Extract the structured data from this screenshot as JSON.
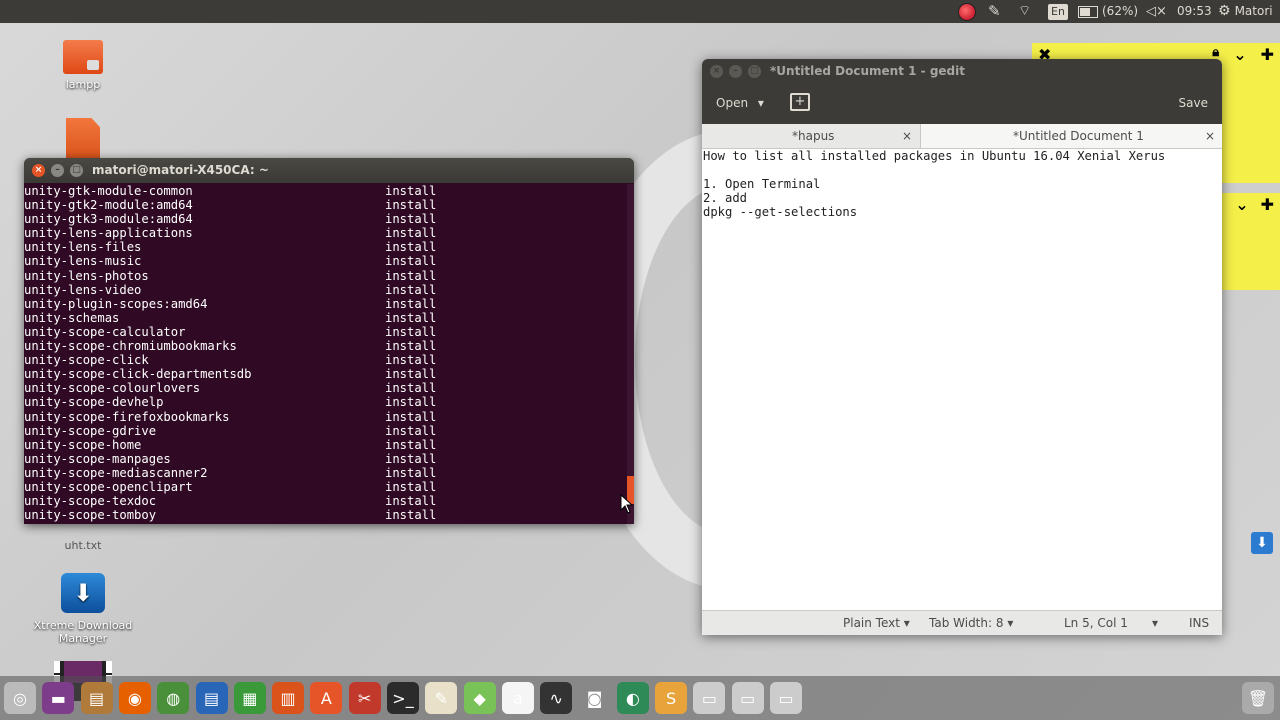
{
  "top_panel": {
    "keyboard": "En",
    "battery": "(62%)",
    "time": "09:53",
    "user": "Matori"
  },
  "desktop_icons": [
    {
      "label": "lampp"
    },
    {
      "label": "uht.txt"
    },
    {
      "label": "Xtreme Download Manager"
    }
  ],
  "terminal": {
    "title": "matori@matori-X450CA: ~",
    "rows": [
      {
        "pkg": "unity-gtk-module-common",
        "status": "install"
      },
      {
        "pkg": "unity-gtk2-module:amd64",
        "status": "install"
      },
      {
        "pkg": "unity-gtk3-module:amd64",
        "status": "install"
      },
      {
        "pkg": "unity-lens-applications",
        "status": "install"
      },
      {
        "pkg": "unity-lens-files",
        "status": "install"
      },
      {
        "pkg": "unity-lens-music",
        "status": "install"
      },
      {
        "pkg": "unity-lens-photos",
        "status": "install"
      },
      {
        "pkg": "unity-lens-video",
        "status": "install"
      },
      {
        "pkg": "unity-plugin-scopes:amd64",
        "status": "install"
      },
      {
        "pkg": "unity-schemas",
        "status": "install"
      },
      {
        "pkg": "unity-scope-calculator",
        "status": "install"
      },
      {
        "pkg": "unity-scope-chromiumbookmarks",
        "status": "install"
      },
      {
        "pkg": "unity-scope-click",
        "status": "install"
      },
      {
        "pkg": "unity-scope-click-departmentsdb",
        "status": "install"
      },
      {
        "pkg": "unity-scope-colourlovers",
        "status": "install"
      },
      {
        "pkg": "unity-scope-devhelp",
        "status": "install"
      },
      {
        "pkg": "unity-scope-firefoxbookmarks",
        "status": "install"
      },
      {
        "pkg": "unity-scope-gdrive",
        "status": "install"
      },
      {
        "pkg": "unity-scope-home",
        "status": "install"
      },
      {
        "pkg": "unity-scope-manpages",
        "status": "install"
      },
      {
        "pkg": "unity-scope-mediascanner2",
        "status": "install"
      },
      {
        "pkg": "unity-scope-openclipart",
        "status": "install"
      },
      {
        "pkg": "unity-scope-texdoc",
        "status": "install"
      },
      {
        "pkg": "unity-scope-tomboy",
        "status": "install"
      }
    ]
  },
  "gedit": {
    "title": "*Untitled Document 1 - gedit",
    "open_label": "Open",
    "save_label": "Save",
    "tabs": [
      {
        "label": "*hapus"
      },
      {
        "label": "*Untitled Document 1"
      }
    ],
    "lines": [
      "How to list all installed packages in Ubuntu 16.04 Xenial Xerus",
      "",
      "1. Open Terminal",
      "2. add",
      "dpkg --get-selections"
    ],
    "status": {
      "language": "Plain Text",
      "tab_width": "Tab Width: 8",
      "position": "Ln 5, Col 1",
      "mode": "INS"
    }
  },
  "colors": {
    "terminal_bg": "#300a24",
    "ubuntu_orange": "#e65527",
    "panel": "#3c3b37",
    "sticky": "#f5f049"
  },
  "dock_icons": [
    "dash-icon",
    "files-icon",
    "archive-icon",
    "firefox-icon",
    "chrome-icon",
    "writer-icon",
    "calc-icon",
    "impress-icon",
    "software-center-icon",
    "settings-icon",
    "terminal-icon",
    "text-editor-icon",
    "android-studio-icon",
    "amazon-icon",
    "system-monitor-icon",
    "screenshot-icon",
    "globe-icon",
    "sublime-icon",
    "drive-icon",
    "drive-icon",
    "drive-icon",
    "trash-icon"
  ]
}
